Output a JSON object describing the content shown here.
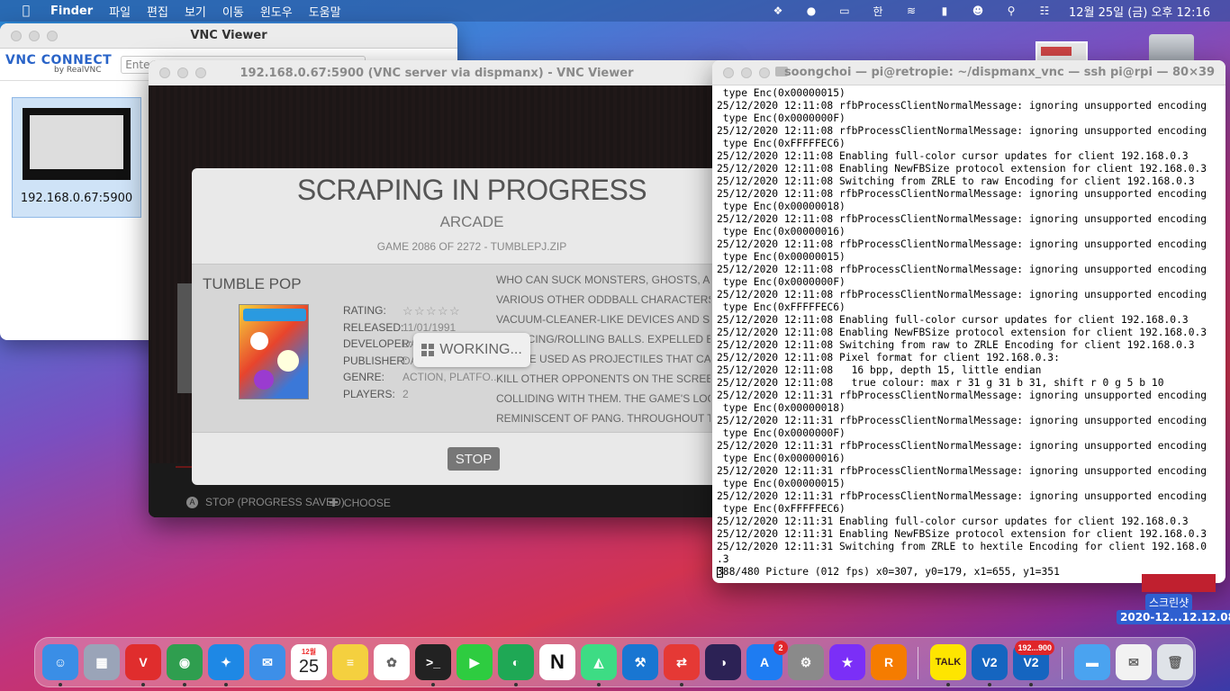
{
  "menubar": {
    "app": "Finder",
    "items": [
      "파일",
      "편집",
      "보기",
      "이동",
      "윈도우",
      "도움말"
    ],
    "clock": "12월 25일 (금) 오후  12:16"
  },
  "addr_window": {
    "title": "VNC Viewer",
    "logo_main": "VNC CONNECT",
    "logo_sub": "by RealVNC",
    "search_placeholder": "Enter a",
    "connection_label": "192.168.0.67:5900"
  },
  "vnc_window": {
    "title": "192.168.0.67:5900 (VNC server via dispmanx) - VNC Viewer",
    "dialog": {
      "title": "SCRAPING IN PROGRESS",
      "system": "ARCADE",
      "sub": "GAME 2086 OF 2272 - TUMBLEPJ.ZIP",
      "game_name": "TUMBLE POP",
      "meta": [
        {
          "key": "RATING:",
          "value": ""
        },
        {
          "key": "RELEASED:",
          "value": "11/01/1991"
        },
        {
          "key": "DEVELOPER:",
          "value": "DA"
        },
        {
          "key": "PUBLISHER:",
          "value": "DA"
        },
        {
          "key": "GENRE:",
          "value": "ACTION, PLATFO..."
        },
        {
          "key": "PLAYERS:",
          "value": "2"
        }
      ],
      "rating_stars": 0,
      "description": [
        "WHO CAN SUCK MONSTERS, GHOSTS, ALIENS AN",
        "VARIOUS OTHER ODDBALL CHARACTERS INTO",
        "VACUUM-CLEANER-LIKE DEVICES AND SPIT THEM",
        "BOUNCING/ROLLING BALLS. EXPELLED ENEM",
        "CAN BE USED AS PROJECTILES THAT CAN DAMAGE A",
        "KILL OTHER OPPONENTS ON THE SCREEN WHEN",
        "COLLIDING WITH THEM. THE GAME'S LOOKS ARE",
        "REMINISCENT OF PANG. THROUGHOUT THE GAM"
      ],
      "working_label": "WORKING...",
      "stop_label": "STOP"
    },
    "hints": {
      "a_button": "A",
      "stop_hint": "STOP (PROGRESS SAVED)",
      "choose_hint": "CHOOSE"
    }
  },
  "terminal": {
    "title": "soongchoi — pi@retropie: ~/dispmanx_vnc — ssh pi@rpi — 80×39",
    "lines": [
      " type Enc(0x00000015)",
      "25/12/2020 12:11:08 rfbProcessClientNormalMessage: ignoring unsupported encoding",
      " type Enc(0x0000000F)",
      "25/12/2020 12:11:08 rfbProcessClientNormalMessage: ignoring unsupported encoding",
      " type Enc(0xFFFFFEC6)",
      "25/12/2020 12:11:08 Enabling full-color cursor updates for client 192.168.0.3",
      "25/12/2020 12:11:08 Enabling NewFBSize protocol extension for client 192.168.0.3",
      "25/12/2020 12:11:08 Switching from ZRLE to raw Encoding for client 192.168.0.3",
      "25/12/2020 12:11:08 rfbProcessClientNormalMessage: ignoring unsupported encoding",
      " type Enc(0x00000018)",
      "25/12/2020 12:11:08 rfbProcessClientNormalMessage: ignoring unsupported encoding",
      " type Enc(0x00000016)",
      "25/12/2020 12:11:08 rfbProcessClientNormalMessage: ignoring unsupported encoding",
      " type Enc(0x00000015)",
      "25/12/2020 12:11:08 rfbProcessClientNormalMessage: ignoring unsupported encoding",
      " type Enc(0x0000000F)",
      "25/12/2020 12:11:08 rfbProcessClientNormalMessage: ignoring unsupported encoding",
      " type Enc(0xFFFFFEC6)",
      "25/12/2020 12:11:08 Enabling full-color cursor updates for client 192.168.0.3",
      "25/12/2020 12:11:08 Enabling NewFBSize protocol extension for client 192.168.0.3",
      "25/12/2020 12:11:08 Switching from raw to ZRLE Encoding for client 192.168.0.3",
      "25/12/2020 12:11:08 Pixel format for client 192.168.0.3:",
      "25/12/2020 12:11:08   16 bpp, depth 15, little endian",
      "25/12/2020 12:11:08   true colour: max r 31 g 31 b 31, shift r 0 g 5 b 10",
      "25/12/2020 12:11:31 rfbProcessClientNormalMessage: ignoring unsupported encoding",
      " type Enc(0x00000018)",
      "25/12/2020 12:11:31 rfbProcessClientNormalMessage: ignoring unsupported encoding",
      " type Enc(0x0000000F)",
      "25/12/2020 12:11:31 rfbProcessClientNormalMessage: ignoring unsupported encoding",
      " type Enc(0x00000016)",
      "25/12/2020 12:11:31 rfbProcessClientNormalMessage: ignoring unsupported encoding",
      " type Enc(0x00000015)",
      "25/12/2020 12:11:31 rfbProcessClientNormalMessage: ignoring unsupported encoding",
      " type Enc(0xFFFFFEC6)",
      "25/12/2020 12:11:31 Enabling full-color cursor updates for client 192.168.0.3",
      "25/12/2020 12:11:31 Enabling NewFBSize protocol extension for client 192.168.0.3",
      "25/12/2020 12:11:31 Switching from ZRLE to hextile Encoding for client 192.168.0",
      ".3"
    ],
    "last_line": "388/480 Picture (012 fps) x0=307, y0=179, x1=655, y1=351"
  },
  "desktop": {
    "screenshot_name": "스크린샷",
    "screenshot_sub": "2020-12...12.12.08"
  },
  "dock": {
    "calendar_month": "12월",
    "calendar_day": "25",
    "appstore_badge": "2",
    "vnc2_badge": "192...900",
    "kakao_label": "TALK",
    "notion_label": "N",
    "vnc_label": "V2",
    "colors": {
      "finder": "#3a8ee6",
      "vivaldi": "#e02d2d",
      "chrome": "#2f9e4f",
      "safari": "#1e88e5",
      "mail": "#3d8fe8",
      "notes": "#f4d03f",
      "terminal": "#222222",
      "facetime": "#2ecc40",
      "evernote": "#1fa855",
      "notion": "#ffffff",
      "androidstudio": "#3ddc84",
      "xcode": "#1976d2",
      "remote": "#e53935",
      "eclipse": "#2c2255",
      "appstore": "#1e7cf2",
      "prefs": "#8a8a8a",
      "istat": "#7b2ff7",
      "rstudio": "#f57c00",
      "kakao": "#fee500",
      "vnc": "#1565c0",
      "folder": "#4aa3f0"
    }
  }
}
